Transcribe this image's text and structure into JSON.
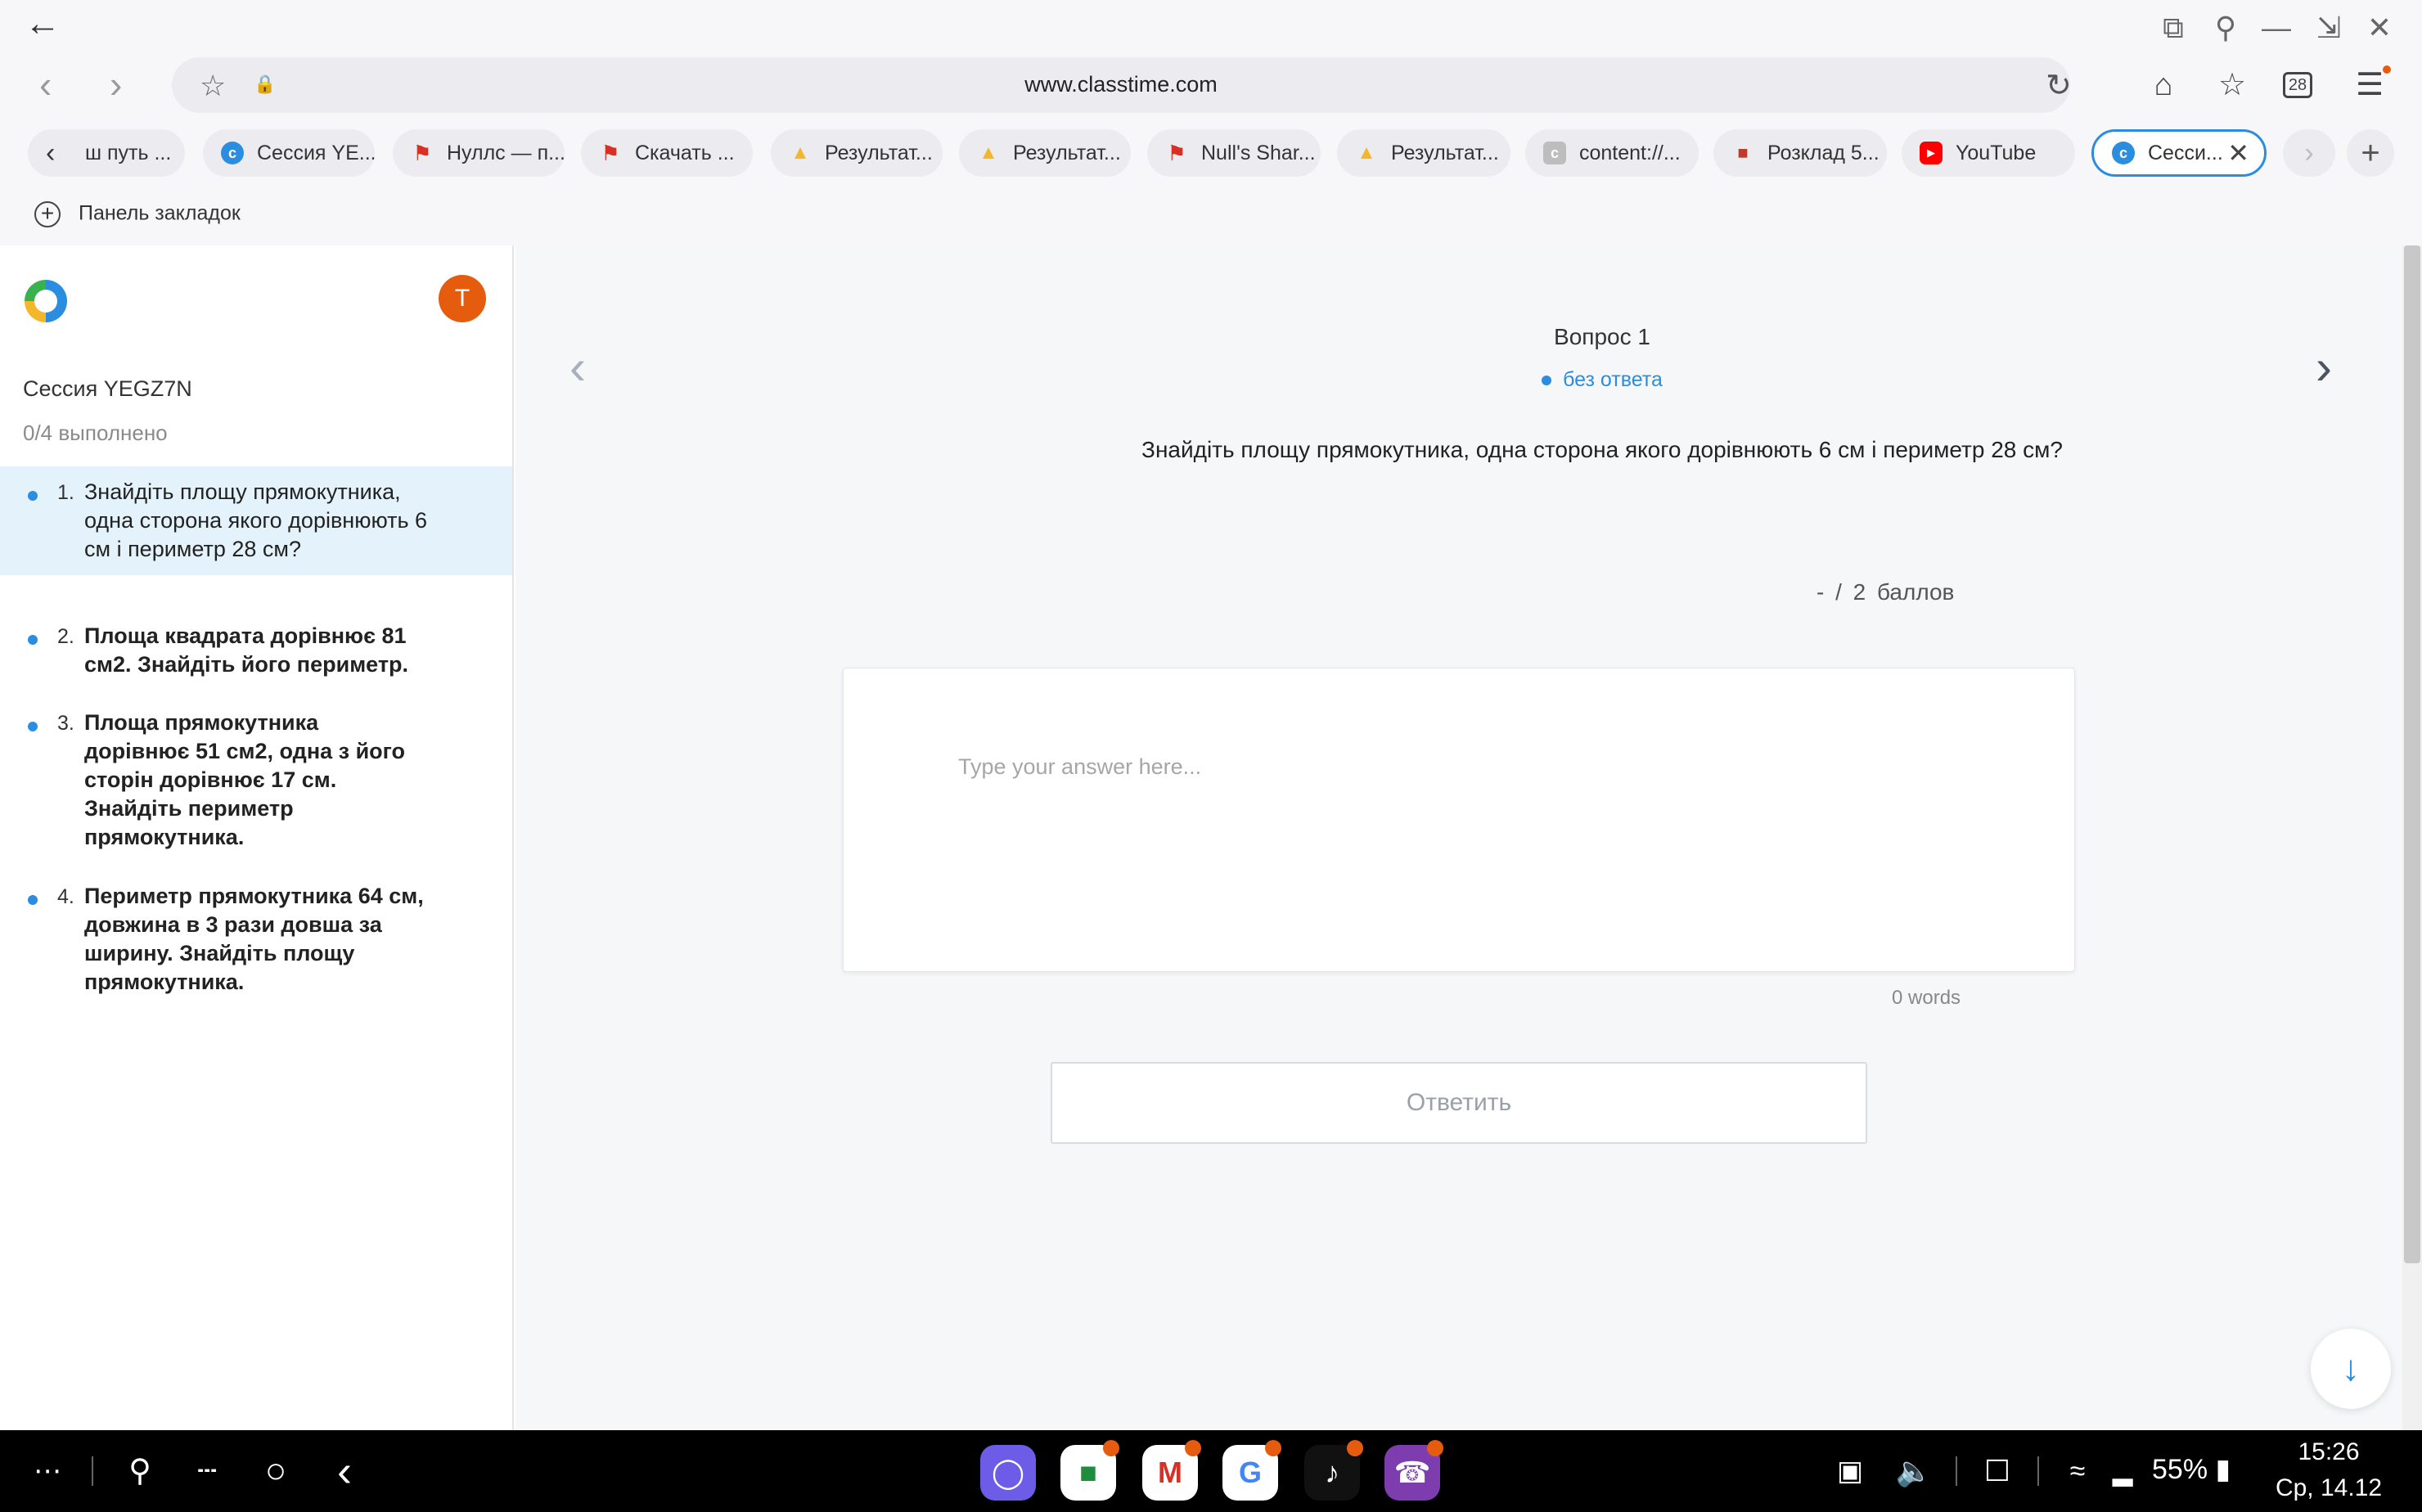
{
  "browser": {
    "url": "www.classtime.com",
    "tab_count": "28",
    "bookmarks_label": "Панель закладок",
    "tabs": [
      {
        "label": "ш путь ...",
        "icon": "chevron-left-icon",
        "color": "#333333"
      },
      {
        "label": "Сессия YE...",
        "icon": "classtime-icon",
        "color": "#2a8de0"
      },
      {
        "label": "Нуллс — п...",
        "icon": "bookmark-icon",
        "color": "#d93025"
      },
      {
        "label": "Скачать ...",
        "icon": "bookmark-icon",
        "color": "#d93025"
      },
      {
        "label": "Результат...",
        "icon": "bell-icon",
        "color": "#f2b72b"
      },
      {
        "label": "Результат...",
        "icon": "bell-icon",
        "color": "#f2b72b"
      },
      {
        "label": "Null's Shar...",
        "icon": "bookmark-icon",
        "color": "#d93025"
      },
      {
        "label": "Результат...",
        "icon": "bell-icon",
        "color": "#f2b72b"
      },
      {
        "label": "content://...",
        "icon": "content-icon",
        "color": "#9a9a9a"
      },
      {
        "label": "Розклад 5...",
        "icon": "book-icon",
        "color": "#c0392b"
      },
      {
        "label": "YouTube",
        "icon": "youtube-icon",
        "color": "#ff0000"
      },
      {
        "label": "Сесси...",
        "icon": "classtime-icon",
        "color": "#2a8de0"
      }
    ]
  },
  "sidebar": {
    "avatar_letter": "T",
    "session_title": "Сессия YEGZ7N",
    "progress": "0/4 выполнено",
    "questions": [
      {
        "num": "1.",
        "text": "Знайдіть площу прямокутника, одна сторона якого дорівнюють 6 см і периметр 28 см?"
      },
      {
        "num": "2.",
        "text": "Площа квадрата дорівнює 81 см2. Знайдіть його периметр."
      },
      {
        "num": "3.",
        "text": "Площа прямокутника дорівнює 51 см2, одна з його сторін дорівнює 17 см. Знайдіть периметр прямокутника."
      },
      {
        "num": "4.",
        "text": "Периметр прямокутника 64 см, довжина в 3 рази довша за ширину. Знайдіть площу прямокутника."
      }
    ]
  },
  "question": {
    "title": "Вопрос 1",
    "status": "без ответа",
    "text": "Знайдіть площу прямокутника, одна сторона якого дорівнюють 6 см і периметр 28 см?",
    "points": "- / 2 баллов",
    "answer_placeholder": "Type your answer here...",
    "answer_value": "",
    "word_count": "0 words",
    "submit_label": "Ответить"
  },
  "taskbar": {
    "battery": "55%",
    "time": "15:26",
    "date": "Ср, 14.12"
  },
  "colors": {
    "accent": "#2a8de0",
    "avatar": "#e65c0f",
    "selected_row": "#e4f3fb"
  }
}
